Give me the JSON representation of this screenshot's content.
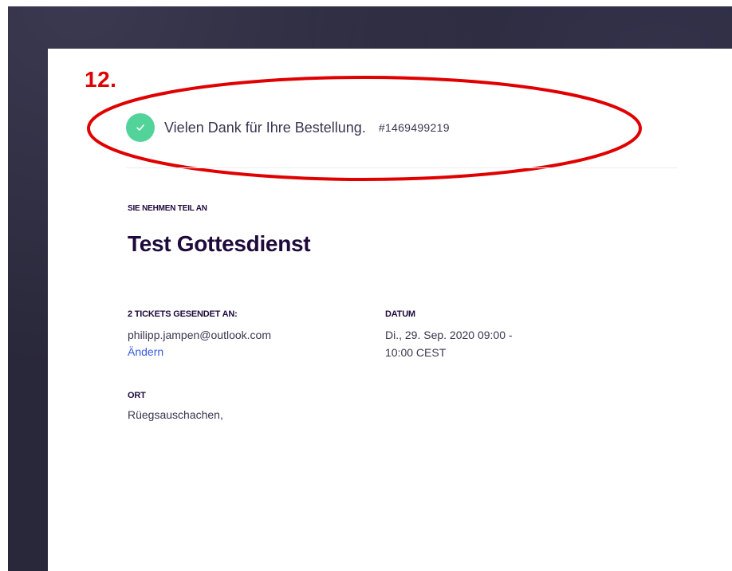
{
  "annotation": {
    "step_label": "12."
  },
  "confirmation": {
    "message": "Vielen Dank für Ihre Bestellung.",
    "order_number": "#1469499219",
    "icon": "checkmark-icon",
    "accent_color": "#52d39a"
  },
  "event": {
    "eyebrow": "SIE NEHMEN TEIL AN",
    "title": "Test Gottesdienst"
  },
  "tickets": {
    "label": "2 TICKETS GESENDET AN:",
    "email": "philipp.jampen@outlook.com",
    "change_link": "Ändern"
  },
  "date": {
    "label": "DATUM",
    "line1": "Di., 29. Sep. 2020 09:00 -",
    "line2": "10:00 CEST"
  },
  "location": {
    "label": "ORT",
    "value": "Rüegsauschachen,"
  },
  "colors": {
    "annotation_red": "#e00000",
    "link_blue": "#3659e3",
    "heading": "#1e0a3c",
    "backdrop": "#29283a"
  }
}
